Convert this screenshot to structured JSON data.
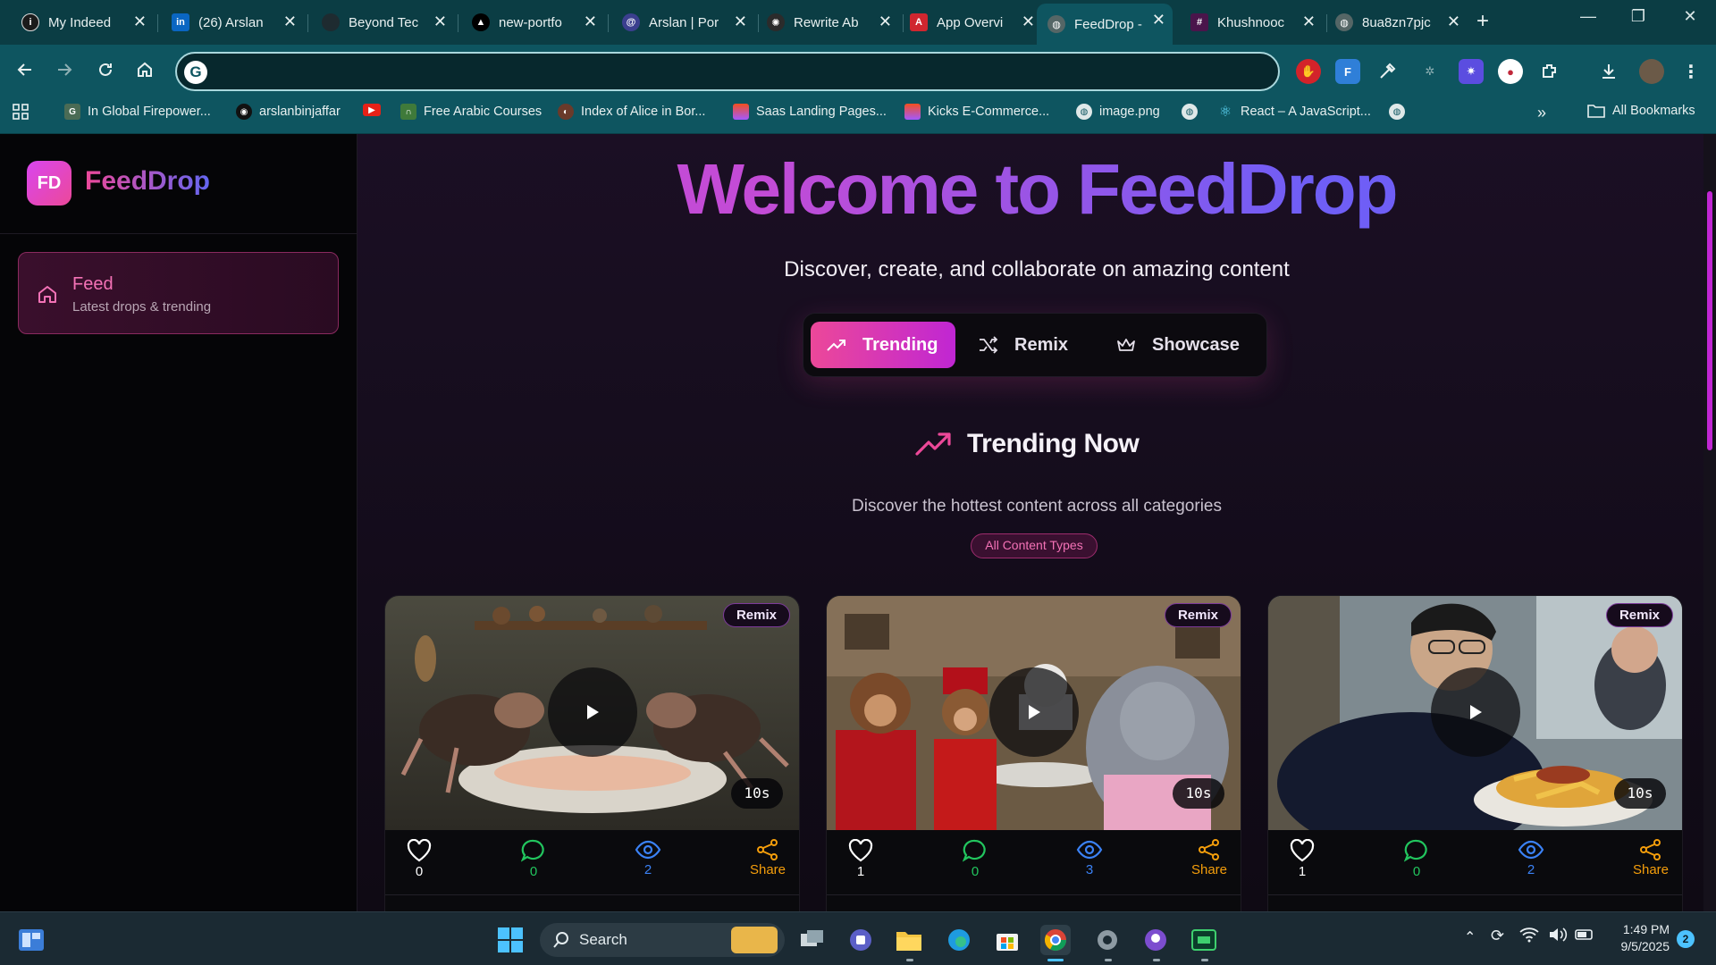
{
  "browser": {
    "tabs": [
      {
        "title": "My Indeed",
        "icon": "indeed-icon",
        "color": "#1b1b1b"
      },
      {
        "title": "(26) Arslan",
        "icon": "linkedin-icon",
        "color": "#0a66c2"
      },
      {
        "title": "Beyond Tec",
        "icon": "site-icon",
        "color": "#1e2b30"
      },
      {
        "title": "new-portfo",
        "icon": "vercel-icon",
        "color": "#000000"
      },
      {
        "title": "Arslan | Por",
        "icon": "portfolio-icon",
        "color": "#3b3f8f"
      },
      {
        "title": "Rewrite Ab",
        "icon": "openai-icon",
        "color": "#2b2b2b"
      },
      {
        "title": "App Overvi",
        "icon": "app-icon",
        "color": "#d0262f"
      },
      {
        "title": "FeedDrop -",
        "icon": "globe-icon",
        "color": "#566"
      },
      {
        "title": "Khushnooc",
        "icon": "slack-icon",
        "color": "#4a154b"
      },
      {
        "title": "8ua8zn7pjc",
        "icon": "globe-icon",
        "color": "#566"
      }
    ],
    "address": {
      "value": "",
      "placeholder": ""
    },
    "bookmarks": [
      {
        "label": "In Global Firepower...",
        "icon": "gfp-icon"
      },
      {
        "label": "arslanbinjaffar",
        "icon": "github-icon"
      },
      {
        "label": "",
        "icon": "youtube-icon"
      },
      {
        "label": "Free Arabic Courses",
        "icon": "course-icon"
      },
      {
        "label": "Index of Alice in Bor...",
        "icon": "firefox-icon"
      },
      {
        "label": "Saas Landing Pages...",
        "icon": "figma-icon"
      },
      {
        "label": "Kicks E-Commerce...",
        "icon": "figma-icon"
      },
      {
        "label": "image.png",
        "icon": "globe-icon"
      },
      {
        "label": "",
        "icon": "globe-icon"
      },
      {
        "label": "React – A JavaScript...",
        "icon": "react-icon"
      },
      {
        "label": "",
        "icon": "globe-icon"
      }
    ],
    "all_bookmarks": "All Bookmarks"
  },
  "app": {
    "logo_text": "FD",
    "brand": "FeedDrop",
    "nav": [
      {
        "label": "Feed",
        "sublabel": "Latest drops & trending",
        "icon": "home-icon"
      }
    ]
  },
  "hero": {
    "title": "Welcome to FeedDrop",
    "tagline": "Discover, create, and collaborate on amazing content"
  },
  "content_tabs": [
    {
      "label": "Trending",
      "icon": "trending-icon",
      "active": true
    },
    {
      "label": "Remix",
      "icon": "shuffle-icon",
      "active": false
    },
    {
      "label": "Showcase",
      "icon": "crown-icon",
      "active": false
    }
  ],
  "section": {
    "title": "Trending Now",
    "subtitle": "Discover the hottest content across all categories",
    "filter": "All Content Types"
  },
  "cards": [
    {
      "badge": "Remix",
      "duration": "10s",
      "likes": "0",
      "comments": "0",
      "views": "2",
      "share": "Share",
      "scene": "crabs-dinner"
    },
    {
      "badge": "Remix",
      "duration": "10s",
      "likes": "1",
      "comments": "0",
      "views": "3",
      "share": "Share",
      "scene": "monkeys-hippo"
    },
    {
      "badge": "Remix",
      "duration": "10s",
      "likes": "1",
      "comments": "0",
      "views": "2",
      "share": "Share",
      "scene": "student-fries"
    }
  ],
  "taskbar": {
    "search": "Search",
    "time": "1:49 PM",
    "date": "9/5/2025",
    "notifications": "2"
  },
  "colors": {
    "accent_pink": "#ec4899",
    "accent_purple": "#c026d3",
    "like": "#ffffff",
    "comment": "#22c55e",
    "view": "#3b82f6",
    "share": "#f59e0b",
    "chrome_teal": "#0e5560"
  }
}
